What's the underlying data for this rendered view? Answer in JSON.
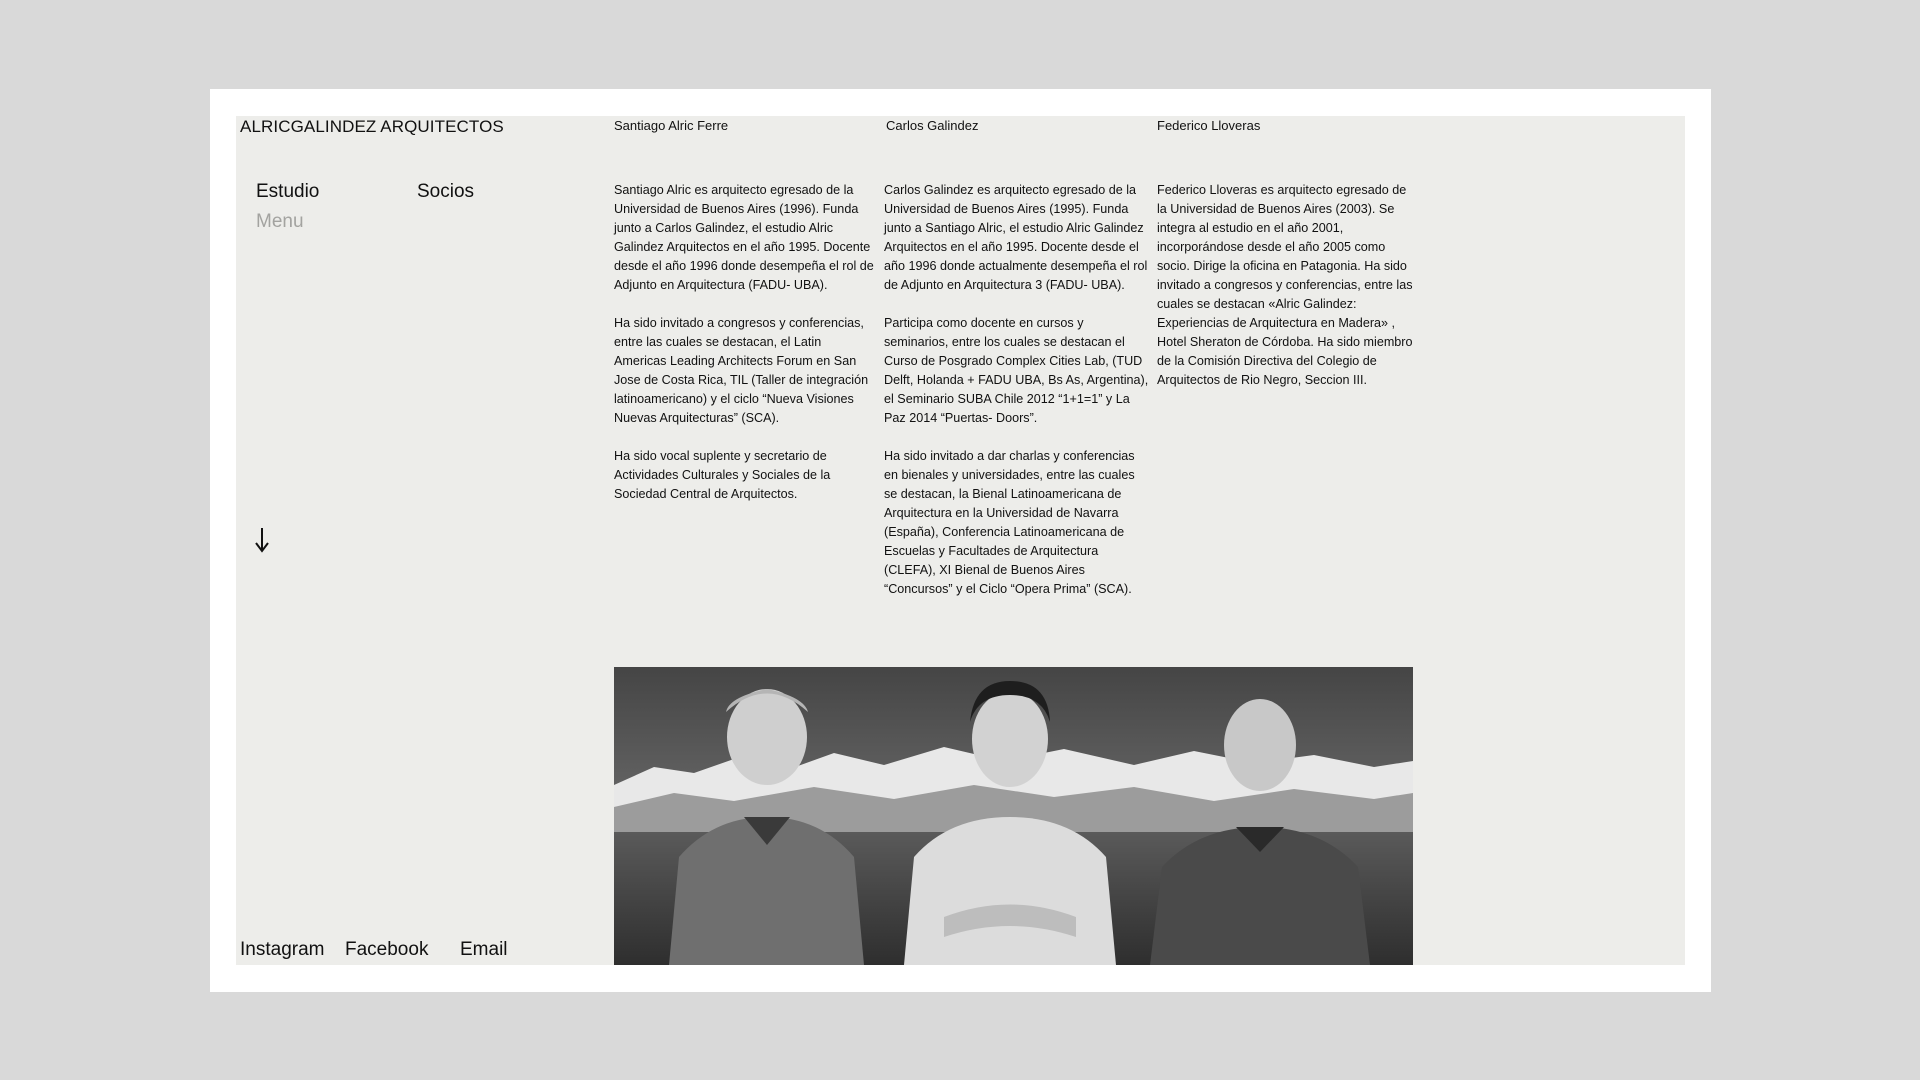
{
  "brand": "ALRICGALINDEZ ARQUITECTOS",
  "nav": {
    "estudio": "Estudio",
    "socios": "Socios",
    "menu": "Menu"
  },
  "footer": {
    "instagram": "Instagram",
    "facebook": "Facebook",
    "email": "Email"
  },
  "partners": [
    {
      "name": "Santiago Alric Ferre",
      "bio": [
        "Santiago Alric es arquitecto egresado de la Universidad de Buenos Aires (1996). Funda junto a Carlos Galindez, el estudio Alric Galindez Arquitectos en el año 1995. Docente desde el año 1996 donde desempeña el rol de Adjunto en Arquitectura (FADU- UBA).",
        "Ha sido invitado a congresos y conferencias, entre las cuales se destacan, el Latin Americas Leading Architects Forum en San Jose de Costa Rica, TIL (Taller de integración latinoamericano) y el ciclo “Nueva Visiones Nuevas Arquitecturas” (SCA).",
        "Ha sido vocal suplente y secretario de Actividades Culturales y Sociales de la Sociedad Central de Arquitectos."
      ]
    },
    {
      "name": "Carlos Galindez",
      "bio": [
        "Carlos Galindez es arquitecto egresado de la Universidad de Buenos Aires (1995). Funda junto a Santiago Alric, el estudio Alric Galindez Arquitectos en el año 1995. Docente desde el año 1996 donde actualmente desempeña el rol de Adjunto en Arquitectura 3 (FADU- UBA).",
        "Participa como docente en cursos y seminarios, entre los cuales se destacan el Curso de Posgrado Complex Cities Lab, (TUD Delft, Holanda + FADU UBA, Bs As, Argentina), el Seminario SUBA Chile 2012 “1+1=1” y La Paz 2014 “Puertas- Doors”.",
        "Ha sido invitado a dar charlas y conferencias en bienales y universidades, entre las cuales se destacan, la Bienal Latinoamericana de Arquitectura en la Universidad de Navarra (España), Conferencia Latinoamericana de Escuelas y Facultades de Arquitectura (CLEFA), XI Bienal de Buenos Aires “Concursos” y el Ciclo “Opera Prima” (SCA)."
      ]
    },
    {
      "name": "Federico Lloveras",
      "bio": [
        "Federico Lloveras es arquitecto egresado de la Universidad de Buenos Aires (2003). Se integra al estudio en el año 2001, incorporándose desde el año 2005 como socio. Dirige la oficina en Patagonia. Ha sido invitado a congresos y conferencias, entre las cuales se destacan «Alric Galindez: Experiencias de Arquitectura en Madera» , Hotel Sheraton de Córdoba. Ha sido miembro de la Comisión Directiva del Colegio de Arquitectos de Rio Negro, Seccion III."
      ]
    }
  ],
  "icons": {
    "scroll": "arrow-down-icon"
  },
  "colors": {
    "page_bg": "#ededea",
    "outer_bg": "#d9d9d9",
    "menu_muted": "#a3a3a0"
  }
}
